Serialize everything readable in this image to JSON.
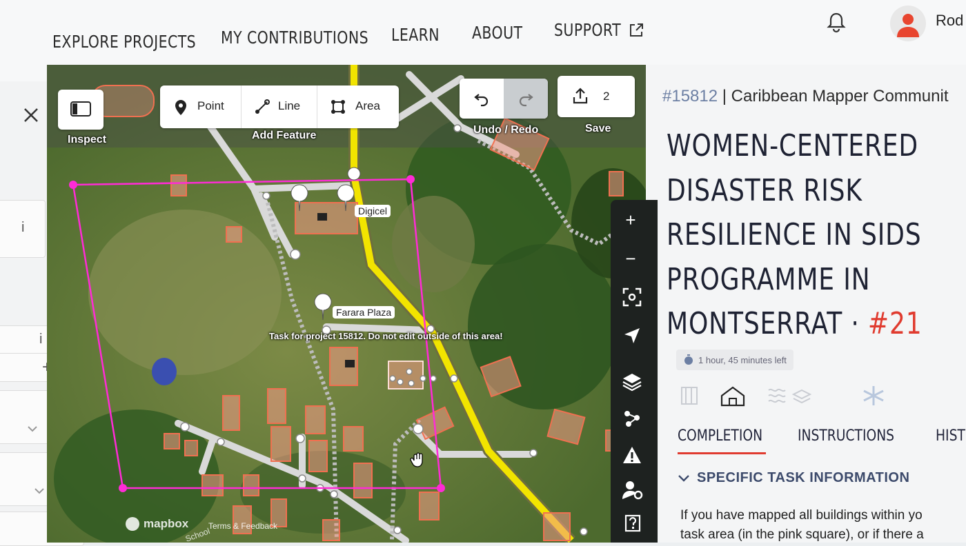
{
  "nav": {
    "links": [
      "EXPLORE PROJECTS",
      "MY CONTRIBUTIONS",
      "LEARN",
      "ABOUT",
      "SUPPORT"
    ],
    "user_name": "Rod"
  },
  "left_panel": {
    "info_label": "i",
    "plus_label": "+"
  },
  "toolbar": {
    "inspect_label": "Inspect",
    "point_label": "Point",
    "line_label": "Line",
    "area_label": "Area",
    "add_feature_label": "Add Feature",
    "undo_redo_label": "Undo / Redo",
    "save_label": "Save",
    "save_count": "2"
  },
  "map": {
    "poi_digicel": "Digicel",
    "poi_farara_plaza": "Farara Plaza",
    "task_notice": "Task for project 15812. Do not edit outside of this area!",
    "attribution": "Terms & Feedback",
    "logo_text": "mapbox",
    "road_label": "School",
    "colors": {
      "task_boundary": "#ff2bd6",
      "main_road": "#f2e400",
      "building": "#f39a86",
      "path": "#d7d7d7"
    }
  },
  "project": {
    "id": "#15812",
    "organisation": "| Caribbean Mapper Communit",
    "title_lines": [
      "WOMEN-CENTERED",
      "DISASTER RISK",
      "RESILIENCE IN SIDS",
      "PROGRAMME IN",
      "MONTSERRAT ·"
    ],
    "task_number": "#21",
    "time_left": "1 hour, 45 minutes left",
    "tabs": [
      "COMPLETION",
      "INSTRUCTIONS",
      "HIST"
    ],
    "section_title": "SPECIFIC TASK INFORMATION",
    "body_lines": [
      "If you have mapped all buildings within yo",
      "task area (in the pink square), or if there a"
    ],
    "accent_color": "#e03b2f"
  }
}
